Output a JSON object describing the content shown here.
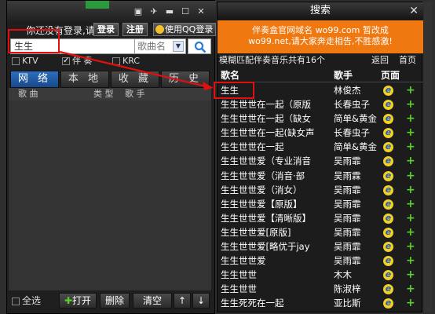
{
  "left_window": {
    "login_msg": "你还没有登录,请",
    "login_btn": "登录",
    "register_btn": "注册",
    "qq_btn": "使用QQ登录",
    "search": {
      "value": "生生",
      "select": "歌曲名"
    },
    "options": {
      "ktv": "KTV",
      "accomp": "伴 奏",
      "krc": "KRC"
    },
    "tabs": [
      "网 络",
      "本 地",
      "收 藏",
      "历 史"
    ],
    "columns": [
      "歌 曲",
      "类 型",
      "歌 手"
    ],
    "bottom": {
      "select_all": "全选",
      "play": "打开",
      "delete": "删除",
      "clear": "清空",
      "up": "↑",
      "down": "↓"
    }
  },
  "right_window": {
    "title": "搜索",
    "banner_line1": "伴奏盒官网域名 wo99.com 暂改成",
    "banner_line2": "wo99.net,请大家奔走相告,不胜感激!",
    "info": "模糊匹配伴奏音乐共有16个",
    "back": "返回",
    "home": "首页",
    "headers": {
      "name": "歌名",
      "singer": "歌手",
      "page": "页面"
    },
    "rows": [
      {
        "name": "生生",
        "singer": "林俊杰"
      },
      {
        "name": "生生世世在一起（原版",
        "singer": "长春虫子"
      },
      {
        "name": "生生世世在一起（缺女",
        "singer": "简单&黄金"
      },
      {
        "name": "生生世世在一起(缺女声",
        "singer": "长春虫子"
      },
      {
        "name": "生生世世在一起",
        "singer": "简单&黄金"
      },
      {
        "name": "生生世世爱（专业消音",
        "singer": "吴雨霏"
      },
      {
        "name": "生生世世爱（消音·部",
        "singer": "吴雨霖"
      },
      {
        "name": "生生世世爱（消女）",
        "singer": "吴雨霏"
      },
      {
        "name": "生生世世爱【原版】",
        "singer": "吴雨霏"
      },
      {
        "name": "生生世世爱【清晰版】",
        "singer": "吴雨霏"
      },
      {
        "name": "生生世世爱[原版]",
        "singer": "吴雨霏"
      },
      {
        "name": "生生世世爱[略优于jay",
        "singer": "吴雨霏"
      },
      {
        "name": "生生世世爱",
        "singer": "吴雨霏"
      },
      {
        "name": "生生世世",
        "singer": "木木"
      },
      {
        "name": "生生世世",
        "singer": "陈淑梓"
      },
      {
        "name": "生生死死在一起",
        "singer": "亚比斯"
      }
    ]
  }
}
